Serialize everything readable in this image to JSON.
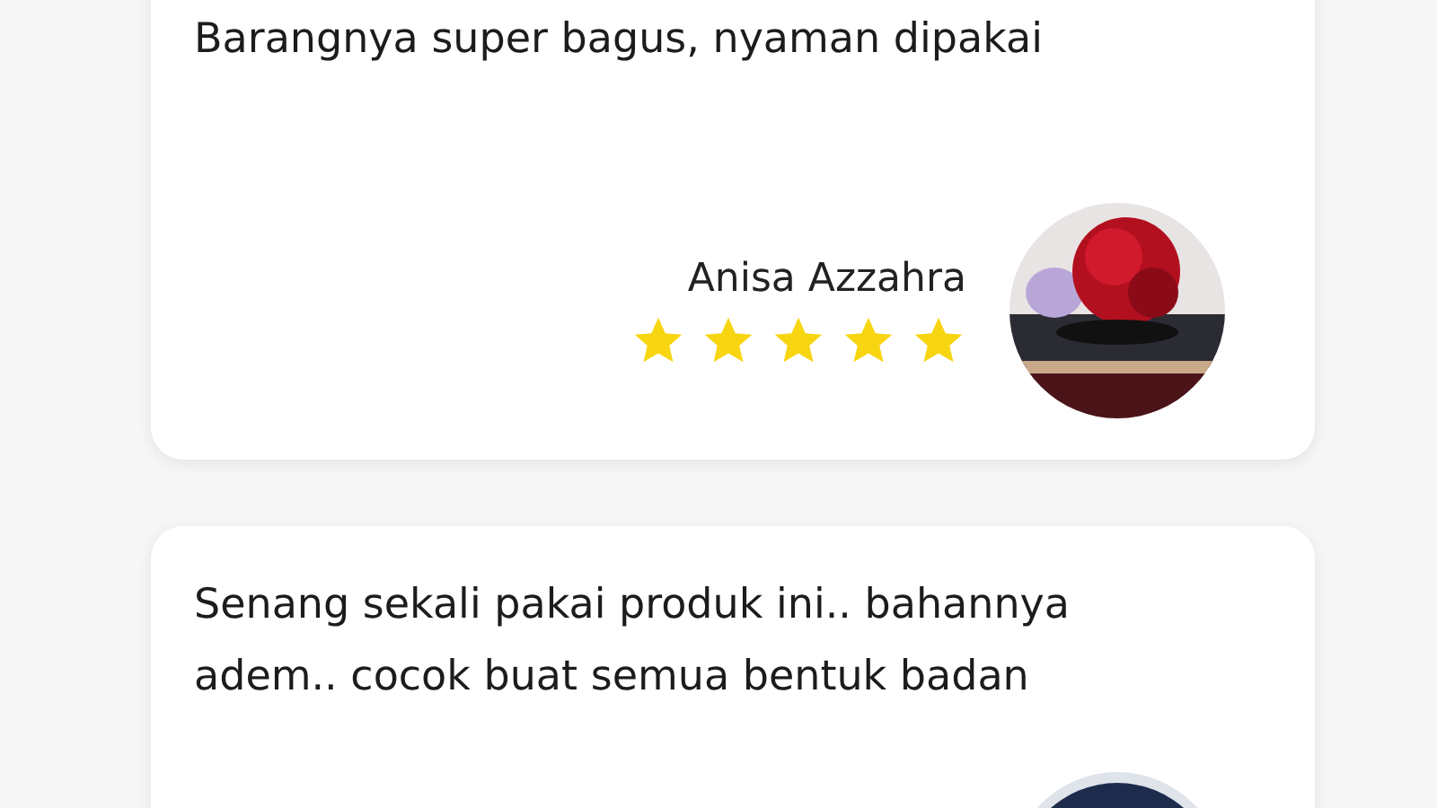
{
  "reviews": [
    {
      "text": "Barangnya super bagus, nyaman dipakai",
      "reviewer": "Anisa Azzahra",
      "stars": 5
    },
    {
      "text": "Senang sekali pakai produk ini.. bahannya adem.. cocok buat semua bentuk badan"
    }
  ]
}
